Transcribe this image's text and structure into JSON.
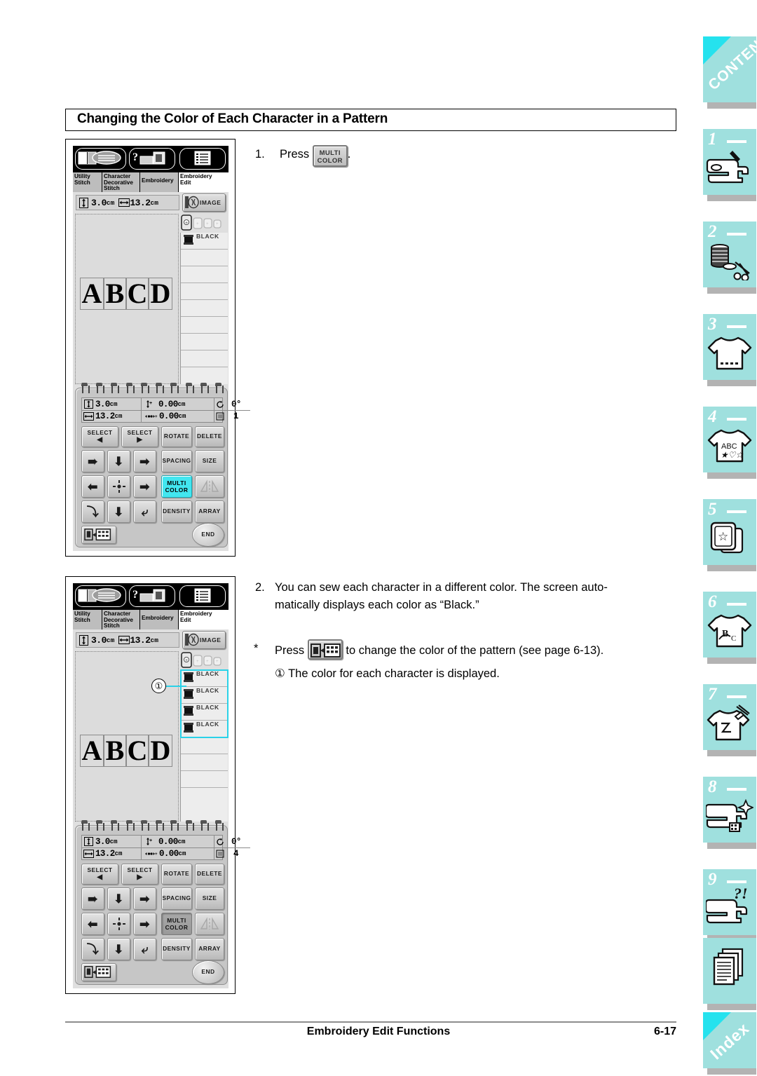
{
  "header": {
    "title": "Changing the Color of Each Character in a Pattern"
  },
  "steps": {
    "step1": {
      "number": "1.",
      "text_before": "Press",
      "button_line1": "MULTI",
      "button_line2": "COLOR",
      "text_after": "."
    },
    "step2": {
      "number": "2.",
      "line1": "You can sew each character in a different color. The screen auto-",
      "line2": "matically displays each color as “Black.”"
    },
    "note": {
      "marker": "*",
      "text_before": "Press",
      "text_after": "to change the color of the pattern (see page 6-13)."
    },
    "callout": {
      "marker": "①",
      "text": "The color for each character is displayed."
    }
  },
  "figure1": {
    "tabs": [
      {
        "label_line1": "Utility",
        "label_line2": "Stitch",
        "label_line3": "",
        "state": "active"
      },
      {
        "label_line1": "Character",
        "label_line2": "Decorative",
        "label_line3": "Stitch",
        "state": "active"
      },
      {
        "label_line1": "Embroidery",
        "label_line2": "",
        "label_line3": "",
        "state": "active"
      },
      {
        "label_line1": "Embroidery",
        "label_line2": "Edit",
        "label_line3": "",
        "state": "selected"
      }
    ],
    "size": {
      "height_value": "3.0",
      "height_unit": "cm",
      "width_value": "13.2",
      "width_unit": "cm"
    },
    "image_button": {
      "label": "IMAGE"
    },
    "pattern": {
      "characters": [
        "A",
        "B",
        "C",
        "D"
      ]
    },
    "colors": [
      "BLACK"
    ],
    "empty_rows": 8,
    "info": {
      "size_h_value": "3.0",
      "size_h_unit": "cm",
      "size_w_value": "13.2",
      "size_w_unit": "cm",
      "offset_v_value": "0.00",
      "offset_v_unit": "cm",
      "offset_h_value": "0.00",
      "offset_h_unit": "cm",
      "rotation": "0°",
      "color_count": "1"
    },
    "keys": {
      "select_prev": "SELECT",
      "select_next": "SELECT",
      "rotate": "ROTATE",
      "delete": "DELETE",
      "spacing": "SPACING",
      "size": "SIZE",
      "multi_color_line1": "MULTI",
      "multi_color_line2": "COLOR",
      "density": "DENSITY",
      "array": "ARRAY",
      "end": "END"
    },
    "multi_color_state": "highlighted"
  },
  "figure2": {
    "tabs": [
      {
        "label_line1": "Utility",
        "label_line2": "Stitch",
        "label_line3": "",
        "state": "active"
      },
      {
        "label_line1": "Character",
        "label_line2": "Decorative",
        "label_line3": "Stitch",
        "state": "active"
      },
      {
        "label_line1": "Embroidery",
        "label_line2": "",
        "label_line3": "",
        "state": "active"
      },
      {
        "label_line1": "Embroidery",
        "label_line2": "Edit",
        "label_line3": "",
        "state": "selected"
      }
    ],
    "size": {
      "height_value": "3.0",
      "height_unit": "cm",
      "width_value": "13.2",
      "width_unit": "cm"
    },
    "image_button": {
      "label": "IMAGE"
    },
    "pattern": {
      "characters": [
        "A",
        "B",
        "C",
        "D"
      ]
    },
    "colors": [
      "BLACK",
      "BLACK",
      "BLACK",
      "BLACK"
    ],
    "empty_rows": 4,
    "highlight_color": "#2ad2e8",
    "info": {
      "size_h_value": "3.0",
      "size_h_unit": "cm",
      "size_w_value": "13.2",
      "size_w_unit": "cm",
      "offset_v_value": "0.00",
      "offset_v_unit": "cm",
      "offset_h_value": "0.00",
      "offset_h_unit": "cm",
      "rotation": "0°",
      "color_count": "4"
    },
    "keys": {
      "select_prev": "SELECT",
      "select_next": "SELECT",
      "rotate": "ROTATE",
      "delete": "DELETE",
      "spacing": "SPACING",
      "size": "SIZE",
      "multi_color_line1": "MULTI",
      "multi_color_line2": "COLOR",
      "density": "DENSITY",
      "array": "ARRAY",
      "end": "END"
    },
    "multi_color_state": "pressed"
  },
  "sidebar": {
    "accent_color": "#9fe0de",
    "corner_color": "#25e2ee",
    "tabs": [
      {
        "word": "CONTENTS",
        "number": "",
        "icon": "contents-corner-icon"
      },
      {
        "word": "",
        "number": "1",
        "icon": "sewing-machine-icon"
      },
      {
        "word": "",
        "number": "2",
        "icon": "thread-spool-scissors-icon"
      },
      {
        "word": "",
        "number": "3",
        "icon": "tshirt-stitch-icon"
      },
      {
        "word": "",
        "number": "4",
        "icon": "tshirt-abc-icon"
      },
      {
        "word": "",
        "number": "5",
        "icon": "embroidery-card-star-icon"
      },
      {
        "word": "",
        "number": "6",
        "icon": "tshirt-letters-icon"
      },
      {
        "word": "",
        "number": "7",
        "icon": "tshirt-applique-icon"
      },
      {
        "word": "",
        "number": "8",
        "icon": "machine-sparkle-icon"
      },
      {
        "word": "",
        "number": "9",
        "icon": "machine-question-icon"
      },
      {
        "word": "",
        "number": "",
        "icon": "pages-icon"
      },
      {
        "word": "Index",
        "number": "",
        "icon": "index-corner-icon"
      }
    ]
  },
  "footer": {
    "title": "Embroidery Edit Functions",
    "page": "6-17"
  }
}
